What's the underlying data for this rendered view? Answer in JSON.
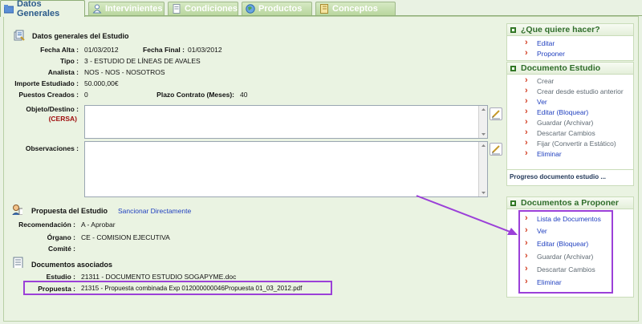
{
  "tabs": [
    {
      "label": "Datos Generales",
      "active": true
    },
    {
      "label": "Intervinientes",
      "active": false
    },
    {
      "label": "Condiciones",
      "active": false
    },
    {
      "label": "Productos",
      "active": false
    },
    {
      "label": "Conceptos",
      "active": false
    }
  ],
  "general": {
    "title": "Datos generales del Estudio",
    "fecha_alta_label": "Fecha Alta :",
    "fecha_alta": "01/03/2012",
    "fecha_final_label": "Fecha Final :",
    "fecha_final": "01/03/2012",
    "tipo_label": "Tipo :",
    "tipo": "3 - ESTUDIO DE LÍNEAS DE AVALES",
    "analista_label": "Analista :",
    "analista": "NOS - NOS - NOSOTROS",
    "importe_label": "Importe Estudiado :",
    "importe": "50.000,00€",
    "puestos_label": "Puestos Creados :",
    "puestos": "0",
    "plazo_label": "Plazo Contrato (Meses):",
    "plazo": "40",
    "objeto_label": "Objeto/Destino :",
    "objeto_sub": "(CERSA)",
    "objeto_value": "",
    "observaciones_label": "Observaciones :",
    "observaciones_value": ""
  },
  "propuesta": {
    "title": "Propuesta del Estudio",
    "sancionar_link": "Sancionar Directamente",
    "recomendacion_label": "Recomendación :",
    "recomendacion": "A - Aprobar",
    "organo_label": "Órgano :",
    "organo": "CE - COMISION EJECUTIVA",
    "comite_label": "Comité :",
    "comite": ""
  },
  "documentos": {
    "title": "Documentos asociados",
    "estudio_label": "Estudio :",
    "estudio": "21311 - DOCUMENTO ESTUDIO SOGAPYME.doc",
    "propuesta_label": "Propuesta :",
    "propuesta": "21315 - Propuesta combinada Exp 012000000046Propuesta 01_03_2012.pdf"
  },
  "sidebar": {
    "quehacer": {
      "title": "¿Que quiere hacer?",
      "items": [
        {
          "label": "Editar",
          "enabled": true
        },
        {
          "label": "Proponer",
          "enabled": true
        }
      ]
    },
    "doc_estudio": {
      "title": "Documento Estudio",
      "items": [
        {
          "label": "Crear",
          "enabled": false
        },
        {
          "label": "Crear desde estudio anterior",
          "enabled": false
        },
        {
          "label": "Ver",
          "enabled": true
        },
        {
          "label": "Editar (Bloquear)",
          "enabled": true
        },
        {
          "label": "Guardar (Archivar)",
          "enabled": false
        },
        {
          "label": "Descartar Cambios",
          "enabled": false
        },
        {
          "label": "Fijar (Convertir a Estático)",
          "enabled": false
        },
        {
          "label": "Eliminar",
          "enabled": true
        }
      ],
      "progress_text": "Progreso documento estudio ..."
    },
    "doc_proponer": {
      "title": "Documentos a Proponer",
      "items": [
        {
          "label": "Lista de Documentos",
          "enabled": true
        },
        {
          "label": "Ver",
          "enabled": true
        },
        {
          "label": "Editar (Bloquear)",
          "enabled": true
        },
        {
          "label": "Guardar (Archivar)",
          "enabled": false
        },
        {
          "label": "Descartar Cambios",
          "enabled": false
        },
        {
          "label": "Eliminar",
          "enabled": true
        }
      ]
    }
  },
  "colors": {
    "annotation": "#9b40d8",
    "link": "#1f3fbf",
    "side_title": "#2f6d2a",
    "bullet_arrow": "#d23b1f"
  }
}
